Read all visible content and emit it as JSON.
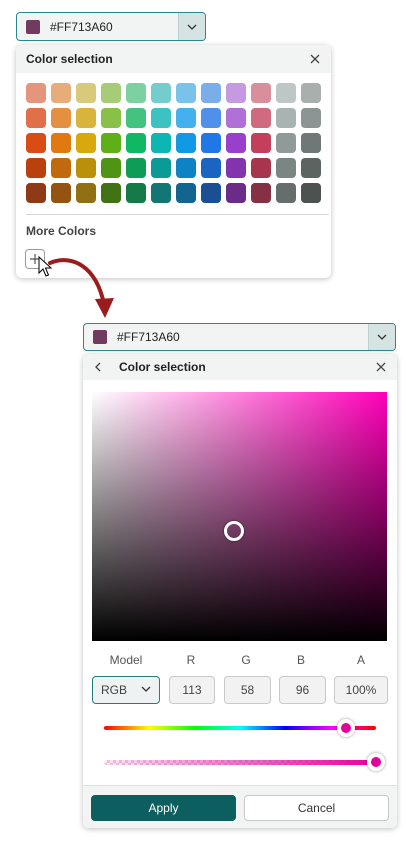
{
  "current_color": {
    "hex_label": "#FF713A60",
    "swatch_color": "#713a60"
  },
  "panel_small": {
    "title": "Color selection",
    "more_colors_label": "More Colors",
    "palette": [
      [
        "#e3967c",
        "#e6ad78",
        "#d9c97a",
        "#a6cc78",
        "#7dd0a1",
        "#74cdcc",
        "#79c2ea",
        "#7aaeea",
        "#c59ae0",
        "#d98e9e",
        "#bec7c5",
        "#a8afad"
      ],
      [
        "#e07048",
        "#e58f40",
        "#d9b43c",
        "#88c048",
        "#43c280",
        "#3cc2c0",
        "#45b0ee",
        "#4f90ea",
        "#b070d8",
        "#d06a80",
        "#a9b3b1",
        "#8c9593"
      ],
      [
        "#d94c14",
        "#e07a10",
        "#d9a80c",
        "#5fb018",
        "#10b865",
        "#0db5b3",
        "#1199e6",
        "#2078e6",
        "#9a3fcc",
        "#c2405c",
        "#909b99",
        "#6f7876"
      ],
      [
        "#b8410f",
        "#c0690d",
        "#b8900a",
        "#4f9415",
        "#0e9c56",
        "#0b9a98",
        "#0e82c4",
        "#1b64c2",
        "#8234ae",
        "#a5364e",
        "#7b8583",
        "#5c6462"
      ],
      [
        "#8e3a17",
        "#955312",
        "#907012",
        "#417216",
        "#147a48",
        "#127674",
        "#12658f",
        "#1a4f93",
        "#6a2c88",
        "#853044",
        "#656e6c",
        "#4b5250"
      ]
    ]
  },
  "panel_large": {
    "title": "Color selection",
    "model_label": "Model",
    "r_label": "R",
    "g_label": "G",
    "b_label": "B",
    "a_label": "A",
    "model_value": "RGB",
    "r_value": "113",
    "g_value": "58",
    "b_value": "96",
    "a_value": "100%",
    "hue_level": 0.89,
    "alpha_level": 1.0,
    "sv_saturation": 0.48,
    "sv_brightness": 0.44,
    "apply_label": "Apply",
    "cancel_label": "Cancel"
  },
  "colors": {
    "accent": "#0d5e5e",
    "border_accent": "#2a8a8a",
    "arrow": "#9b1c1c"
  }
}
